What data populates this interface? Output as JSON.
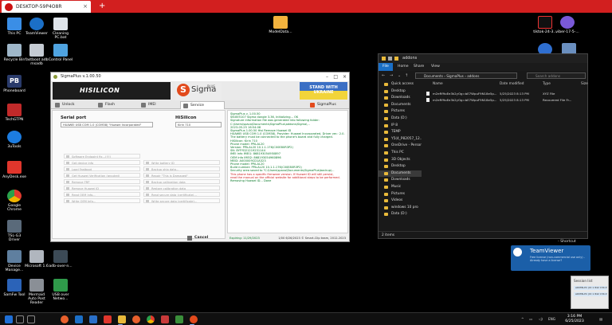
{
  "session": {
    "tab_title": "DESKTOP-59P4O8R",
    "tab_close": "×",
    "add_tab": "+"
  },
  "desktop_icons": [
    {
      "label": "This PC",
      "color": "#3a8ee6"
    },
    {
      "label": "TeamViewer",
      "color": "#1b6fc6"
    },
    {
      "label": "Cleaning PC.bat",
      "color": "#dfe4ea"
    },
    {
      "label": "Recycle Bin",
      "color": "#9fb7c9"
    },
    {
      "label": "fastboot adb msadb",
      "color": "#c5cbd3"
    },
    {
      "label": "Control Panel",
      "color": "#4fa3e0"
    },
    {
      "label": "Phoneboard",
      "color": "#2a3b6b"
    },
    {
      "label": "TechGTPN",
      "color": "#c12a2a"
    },
    {
      "label": "3uTools",
      "color": "#1c7ce0"
    },
    {
      "label": "AnyDesk.exe",
      "color": "#e0362c"
    },
    {
      "label": "Google Chrome",
      "color": "#f0b400"
    },
    {
      "label": "TSL-G3 Driver",
      "color": "#5a6a7a"
    },
    {
      "label": "Device Manage...",
      "color": "#5f7f9f"
    },
    {
      "label": "Microsoft 1.6",
      "color": "#b0b6be"
    },
    {
      "label": "adb-over-n...",
      "color": "#3c4a56"
    },
    {
      "label": "SamFw Tool",
      "color": "#2b63b8"
    },
    {
      "label": "Mermaid Auto Post Reader",
      "color": "#8a8f96"
    },
    {
      "label": "USB over Netwo...",
      "color": "#2f9a4a"
    },
    {
      "label": "ModelData...",
      "color": "#f3b33d"
    },
    {
      "label": "tiktok-24-3...",
      "color": "#111111"
    },
    {
      "label": "viber-17-5-...",
      "color": "#7a59d8"
    }
  ],
  "sigma": {
    "title": "SigmaPlus v.1.00.50",
    "banner_hisilicon": "HISILICON",
    "sigma_logo": "Sigma",
    "sigma_logo_plus": "PLUS",
    "ukraine": "STAND WITH UKRAINE",
    "tabs": [
      "Unlock",
      "Flash",
      "IMEI",
      "Service",
      "SigmaPlus"
    ],
    "serial_port_label": "Serial port",
    "serial_port_value": "HUAWEI USB COM 1.0 (COM38) \"Huawei Incorporated\"",
    "hisilicon_label": "HiSilicon",
    "hisilicon_value": "Kirin 710",
    "buttons_left": [
      "Software Endpoint fix...(!!!)",
      "Get device info",
      "Load Fastboot",
      "Get Huawei Verification (grouted)",
      "Remove FRP",
      "Remove Huawei ID",
      "Read OEM Info...",
      "Write OEM Info..."
    ],
    "buttons_right": [
      "Write battery ID",
      "Backup ship data...",
      "Repair \"This is Damaged\"",
      "Backup calibration data",
      "Restore calibration data",
      "Read secure data (certificate)...",
      "Write secure data (certificate)..."
    ],
    "cancel": "Cancel",
    "log": [
      {
        "t": "SigmaPlus v. 1.00.50",
        "c": "green"
      },
      {
        "t": "SN:8E5107 Sigma dongle 3.36, Initializing... OK",
        "c": "green"
      },
      {
        "t": "Signature information file was generated into following folder:",
        "c": "green"
      },
      {
        "t": "C:\\Users\\spavo\\Documents\\SigmaPlus\\addons\\Sigma\\...",
        "c": "green"
      },
      {
        "t": "2023-05-25 16:54:08",
        "c": "green"
      },
      {
        "t": "SigmaPlus 1.00.50 Hisi Remove Huawei ID",
        "c": "green"
      },
      {
        "t": "HUAWEI USB COM 1.0 (COM38), Provider: Huawei Incorporated, Driver ver.: 2.0...",
        "c": "green"
      },
      {
        "t": "The battery must be connected to the phone's board and fully charged.",
        "c": "green"
      },
      {
        "t": "HiSilicon: Kirin 710",
        "c": "green"
      },
      {
        "t": "Phone model: PPA-AL20",
        "c": "green"
      },
      {
        "t": "Version: PPA-AL20 10.1.1.176(C00E80R3P2)",
        "c": "green"
      },
      {
        "t": "SN: 8YFYD21219231144",
        "c": "green"
      },
      {
        "t": "IMEI Info IMEI1: 868193054950897",
        "c": "green"
      },
      {
        "t": "OEM Info IMEI2: 868193054960896",
        "c": "green"
      },
      {
        "t": "MEID: A000009CD1A323",
        "c": "green"
      },
      {
        "t": "Phone model: PPA-AL20",
        "c": "green"
      },
      {
        "t": "Build number: PPA-AL20 10.1.1.176(C00E80R3P2)",
        "c": "green"
      },
      {
        "t": "Security area saved to \"C:\\Users\\spavo\\Documents\\SigmaPlus\\backup\\...",
        "c": "green"
      },
      {
        "t": "This phone has a specific firmware version. If Huawei ID will still persist,",
        "c": "red"
      },
      {
        "t": "read the manual on the official website for additional steps to be performed.",
        "c": "red"
      },
      {
        "t": "Removing Huawei ID... Done",
        "c": "green"
      }
    ],
    "expiry": "Expiring: 11/29/2023",
    "version_footer": "1/00 6/26/2023 © Smart-Clip team, 2012-2023"
  },
  "explorer": {
    "title": "addons",
    "ribbon": [
      "File",
      "Home",
      "Share",
      "View"
    ],
    "address": "Documents › SigmaPlus › addons",
    "search_placeholder": "Search addons",
    "nav": [
      "Quick access",
      "Desktop",
      "Downloads",
      "Documents",
      "Pictures",
      "Data (D:)",
      "IP 8",
      "TEMP",
      "Y5(4_P82057_12...",
      "OneDrive - Person...",
      "This PC",
      "3D Objects",
      "Desktop",
      "Documents",
      "Downloads",
      "Music",
      "Pictures",
      "Videos",
      "windows 10 pro",
      "Data (D:)"
    ],
    "columns": [
      "Name",
      "Date modified",
      "Type",
      "Size"
    ],
    "files": [
      {
        "name": "m2eRf9oEe3k2yOg=bE7WpuF9N18e5p...",
        "date": "5/25/2023 8:13 PM",
        "type": "XYZ File"
      },
      {
        "name": "m2eRf9oEe3k2yOg=bE7WpuF9N18e5p...",
        "date": "5/25/2023 8:13 PM",
        "type": "Recovered File Fr..."
      }
    ],
    "status": "2 items",
    "shortcut": "- Shortcut"
  },
  "teamviewer": {
    "title": "TeamViewer",
    "subtitle": "Free license (non-commercial use only) - Already have a license?",
    "session_header": "Session list",
    "sessions": [
      "ADMIN-PC (ID 1 842 156 253)",
      "ADMIN-PC (ID 1 842 156 253)"
    ]
  },
  "taskbar": {
    "time": "3:16 PM",
    "date": "6/25/2023",
    "tray_lang": "ENG"
  }
}
